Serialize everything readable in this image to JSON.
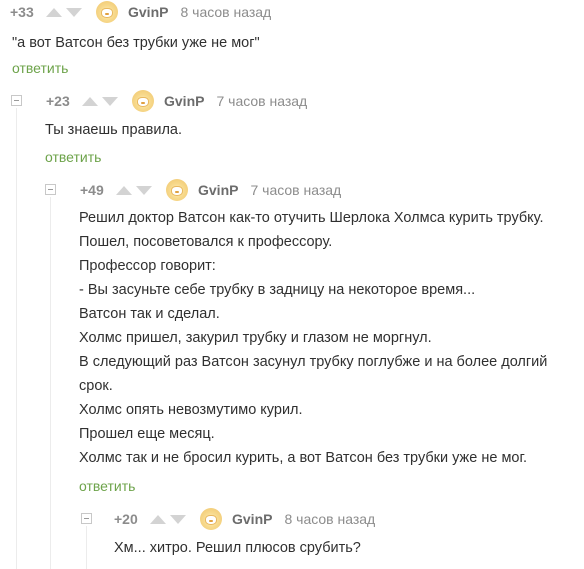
{
  "comments": [
    {
      "rating": "+33",
      "username": "GvinP",
      "time": "8 часов назад",
      "lines": [
        "\"а вот Ватсон без трубки уже не мог\""
      ],
      "reply": "ответить"
    },
    {
      "rating": "+23",
      "username": "GvinP",
      "time": "7 часов назад",
      "lines": [
        "Ты знаешь правила."
      ],
      "reply": "ответить"
    },
    {
      "rating": "+49",
      "username": "GvinP",
      "time": "7 часов назад",
      "lines": [
        "Решил доктор Ватсон как-то отучить Шерлока Холмса курить трубку.",
        "Пошел, посоветовался к профессору.",
        "Профессор говорит:",
        "- Вы засуньте себе трубку в задницу на некоторое время...",
        "Ватсон так и сделал.",
        "Холмс пришел, закурил трубку и глазом не моргнул.",
        "В следующий раз Ватсон засунул трубку поглубже и на более долгий",
        "срок.",
        "Холмс опять невозмутимо курил.",
        "Прошел еще месяц.",
        "Холмс так и не бросил курить, а вот Ватсон без трубки уже не мог."
      ],
      "reply": "ответить"
    },
    {
      "rating": "+20",
      "username": "GvinP",
      "time": "8 часов назад",
      "lines": [
        "Хм... хитро. Решил плюсов срубить?"
      ]
    }
  ]
}
